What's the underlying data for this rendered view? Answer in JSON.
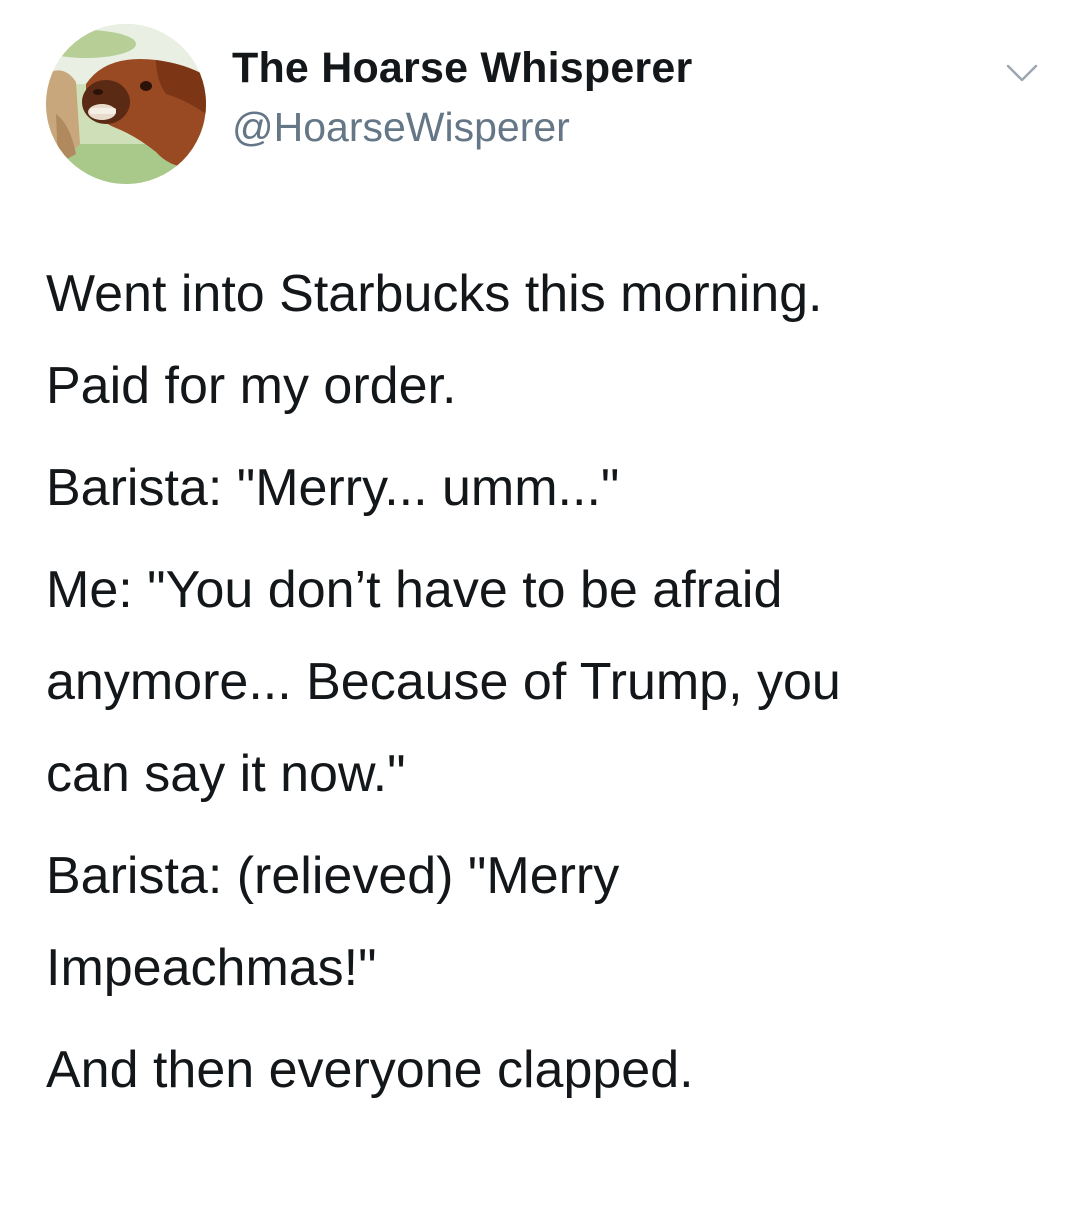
{
  "author": {
    "display_name": "The Hoarse Whisperer",
    "handle": "@HoarseWisperer"
  },
  "icons": {
    "avatar": "horse-avatar",
    "menu": "chevron-down-icon"
  },
  "tweet": {
    "paragraphs": [
      "Went into Starbucks this morning.\nPaid for my order.",
      "Barista: \"Merry... umm...\"",
      "Me: \"You don’t have to be afraid\nanymore... Because of Trump, you\ncan say it now.\"",
      "Barista: (relieved) \"Merry\nImpeachmas!\"",
      "And then everyone clapped."
    ]
  },
  "colors": {
    "text": "#14171a",
    "secondary_text": "#657786",
    "background": "#ffffff"
  }
}
